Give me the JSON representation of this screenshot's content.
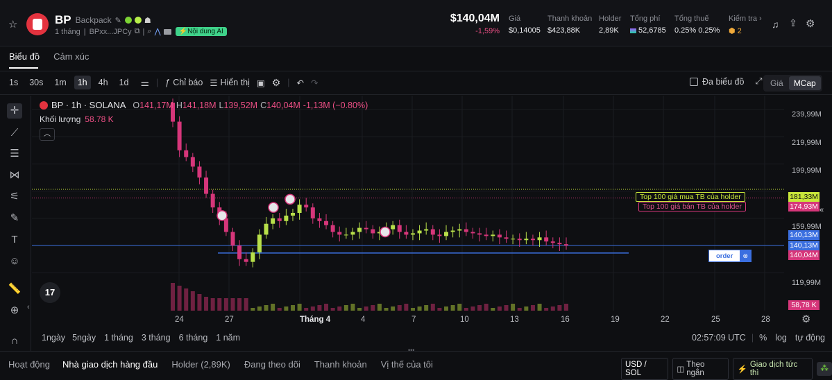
{
  "header": {
    "symbol": "BP",
    "name": "Backpack",
    "age": "1 tháng",
    "address": "BPxx...JPCy",
    "ai_badge": "Nội dung AI",
    "price_big": "$140,04M",
    "change": "-1,59%",
    "stats": [
      {
        "label": "Giá",
        "value": "$0,14005"
      },
      {
        "label": "Thanh khoản",
        "value": "$423,88K"
      },
      {
        "label": "Holder",
        "value": "2,89K"
      },
      {
        "label": "Tổng phí",
        "value": "52,6785"
      },
      {
        "label": "Tổng thuế",
        "value": "0.25% 0.25%"
      },
      {
        "label": "Kiểm tra ›",
        "value": "2"
      }
    ]
  },
  "tabs": [
    "Biểu đồ",
    "Cảm xúc"
  ],
  "toolbar": {
    "timeframes": [
      "1s",
      "30s",
      "1m",
      "1h",
      "4h",
      "1d"
    ],
    "active_timeframe": "1h",
    "indicators": "Chỉ báo",
    "display": "Hiển thị",
    "multi_chart": "Đa biểu đồ",
    "price_toggle": "Giá",
    "mcap_toggle": "MCap"
  },
  "legend": {
    "title": "BP · 1h · SOLANA",
    "o_lbl": "O",
    "o": "141,17M",
    "h_lbl": "H",
    "h": "141,18M",
    "l_lbl": "L",
    "l": "139,52M",
    "c_lbl": "C",
    "c": "140,04M",
    "chg": "-1,13M (−0.80%)",
    "vol_label": "Khối lượng",
    "vol": "58.78 K"
  },
  "chart_data": {
    "type": "candlestick",
    "y_ticks": [
      "239,99M",
      "219,99M",
      "199,99M",
      "159,99M",
      "119,99M"
    ],
    "x_ticks": [
      "24",
      "27",
      "Tháng 4",
      "4",
      "7",
      "10",
      "13",
      "16",
      "19",
      "22",
      "25",
      "28"
    ],
    "ylim": [
      110,
      245
    ],
    "close_series": [
      231,
      210,
      205,
      198,
      190,
      178,
      168,
      160,
      150,
      140,
      130,
      128,
      135,
      148,
      156,
      160,
      158,
      162,
      164,
      170,
      168,
      160,
      158,
      155,
      150,
      148,
      148,
      150,
      153,
      152,
      149,
      150,
      152,
      155,
      150,
      148,
      149,
      151,
      152,
      148,
      147,
      150,
      151,
      152,
      150,
      149,
      148,
      147,
      148,
      146,
      145,
      145,
      144,
      145,
      144,
      146,
      143,
      142,
      141,
      140
    ],
    "markers": [
      {
        "label": "Top 100 giá mua TB của holder",
        "value": "181,33M"
      },
      {
        "label": "Top 100 giá bán TB của holder",
        "value": "174,93M"
      }
    ],
    "price_labels": [
      "140,13M",
      "140,13M",
      "140,04M"
    ],
    "volume_label": "58.78 K",
    "volume_badge": "58,78 K"
  },
  "order_label": "order",
  "ranges": [
    "1ngày",
    "5ngày",
    "1 tháng",
    "3 tháng",
    "6 tháng",
    "1 năm"
  ],
  "clock": "02:57:09 UTC",
  "axis_opts": [
    "%",
    "log",
    "tự động"
  ],
  "bottom_tabs": [
    "Hoạt động",
    "Nhà giao dịch hàng đầu",
    "Holder (2,89K)",
    "Đang theo dõi",
    "Thanh khoản",
    "Vị thế của tôi"
  ],
  "bottom_right": {
    "pair": "USD / SOL",
    "follow": "Theo ngắn",
    "trade": "Giao dịch tức thì"
  }
}
